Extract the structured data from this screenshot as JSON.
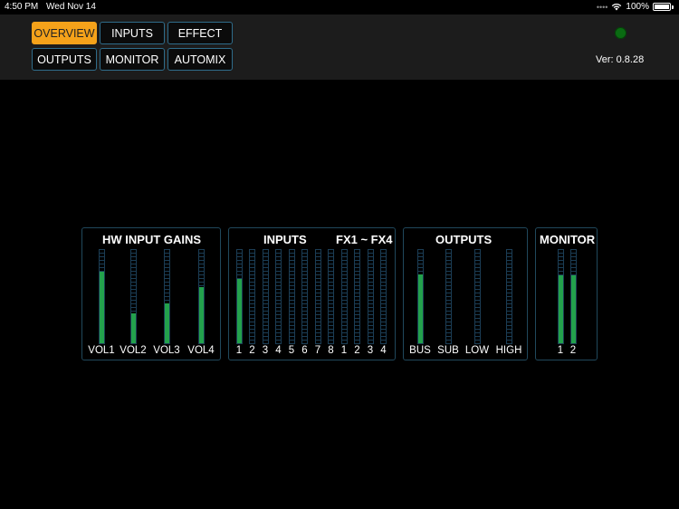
{
  "status_bar": {
    "time": "4:50 PM",
    "date": "Wed Nov 14",
    "battery": "100%",
    "wifi_icon": "wifi-icon",
    "battery_icon": "battery-icon"
  },
  "nav": {
    "tabs": [
      {
        "label": "OVERVIEW",
        "active": true
      },
      {
        "label": "INPUTS",
        "active": false
      },
      {
        "label": "EFFECT",
        "active": false
      },
      {
        "label": "OUTPUTS",
        "active": false
      },
      {
        "label": "MONITOR",
        "active": false
      },
      {
        "label": "AUTOMIX",
        "active": false
      }
    ],
    "accent_color": "#f5a21a"
  },
  "connection_led_color": "#0a6b12",
  "version": "Ver: 0.8.28",
  "panels": {
    "hw_input_gains": {
      "title": "HW INPUT GAINS",
      "meters": [
        {
          "label": "VOL1",
          "level": 0.77
        },
        {
          "label": "VOL2",
          "level": 0.32
        },
        {
          "label": "VOL3",
          "level": 0.43
        },
        {
          "label": "VOL4",
          "level": 0.6
        }
      ]
    },
    "inputs": {
      "title": "INPUTS",
      "fx_title": "FX1 ~ FX4",
      "meters": [
        {
          "label": "1",
          "level": 0.69
        },
        {
          "label": "2",
          "level": 0
        },
        {
          "label": "3",
          "level": 0
        },
        {
          "label": "4",
          "level": 0
        },
        {
          "label": "5",
          "level": 0
        },
        {
          "label": "6",
          "level": 0
        },
        {
          "label": "7",
          "level": 0
        },
        {
          "label": "8",
          "level": 0
        },
        {
          "label": "1",
          "level": 0
        },
        {
          "label": "2",
          "level": 0
        },
        {
          "label": "3",
          "level": 0
        },
        {
          "label": "4",
          "level": 0
        }
      ]
    },
    "outputs": {
      "title": "OUTPUTS",
      "meters": [
        {
          "label": "BUS",
          "level": 0.74
        },
        {
          "label": "SUB",
          "level": 0
        },
        {
          "label": "LOW",
          "level": 0
        },
        {
          "label": "HIGH",
          "level": 0
        }
      ]
    },
    "monitor": {
      "title": "MONITOR",
      "meters": [
        {
          "label": "1",
          "level": 0.73
        },
        {
          "label": "2",
          "level": 0.73
        }
      ]
    }
  },
  "meter_fill_color": "#23a14c"
}
